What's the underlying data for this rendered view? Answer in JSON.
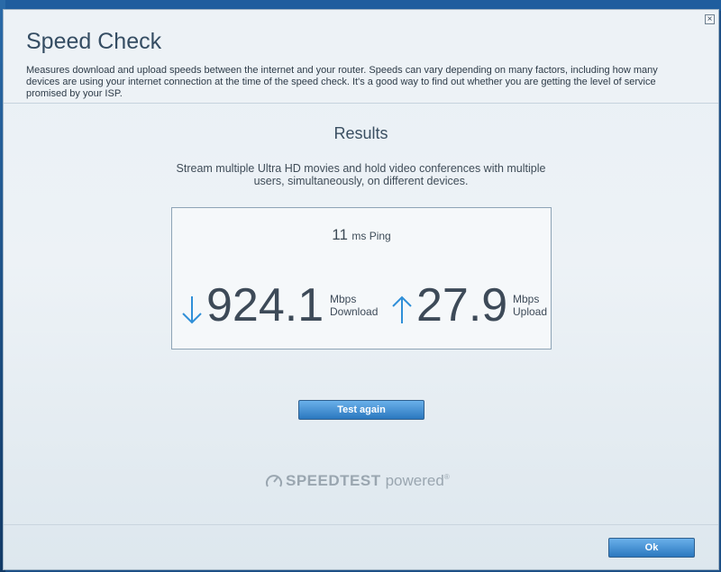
{
  "dialog": {
    "title": "Speed Check",
    "description": "Measures download and upload speeds between the internet and your router. Speeds can vary depending on many factors, including how many devices are using your internet connection at the time of the speed check. It's a good way to find out whether you are getting the level of service promised by your ISP.",
    "close_label": "×"
  },
  "results": {
    "title": "Results",
    "description": "Stream multiple Ultra HD movies and hold video conferences with multiple users, simultaneously, on different devices.",
    "ping_value": "11",
    "ping_unit": "ms Ping",
    "download_value": "924.1",
    "download_unit": "Mbps",
    "download_label": "Download",
    "upload_value": "27.9",
    "upload_unit": "Mbps",
    "upload_label": "Upload"
  },
  "buttons": {
    "test_again": "Test again",
    "ok": "Ok"
  },
  "branding": {
    "brand": "SPEEDTEST",
    "suffix": "powered",
    "mark": "®"
  },
  "colors": {
    "accent": "#2f8fd8",
    "button_top": "#6ab0ea",
    "button_bottom": "#2b78bf"
  },
  "icons": {
    "download": "arrow-down-icon",
    "upload": "arrow-up-icon",
    "close": "close-icon",
    "speedtest": "speedtest-gauge-icon"
  }
}
